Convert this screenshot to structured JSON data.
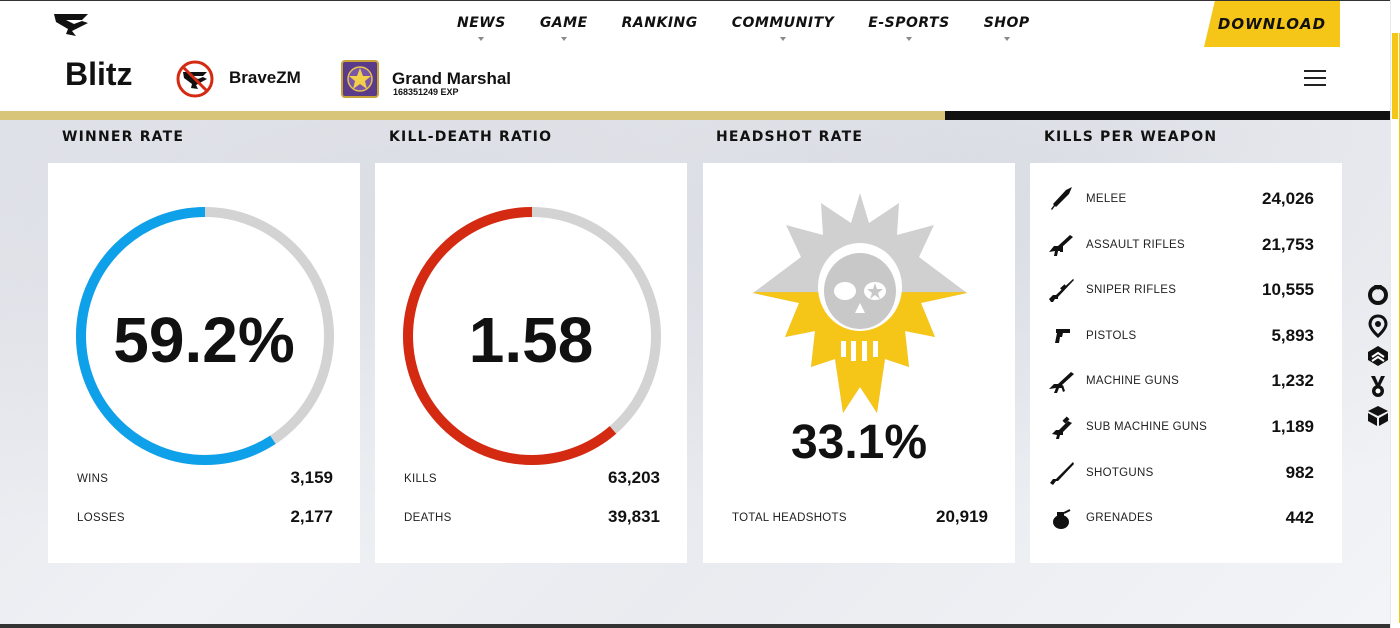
{
  "nav": {
    "items": [
      "NEWS",
      "GAME",
      "RANKING",
      "COMMUNITY",
      "E-SPORTS",
      "SHOP"
    ],
    "items_with_dropdown": [
      true,
      true,
      false,
      true,
      true,
      true
    ],
    "download_label": "DOWNLOAD"
  },
  "player": {
    "name": "Blitz",
    "clan": "BraveZM",
    "rank": "Grand Marshal",
    "exp": "168351249 EXP",
    "exp_progress_fraction": 0.68
  },
  "winner_rate": {
    "title": "WINNER RATE",
    "value": "59.2%",
    "fraction": 0.592,
    "rows": [
      {
        "label": "WINS",
        "value": "3,159"
      },
      {
        "label": "LOSSES",
        "value": "2,177"
      }
    ],
    "color": "#0ea1ea"
  },
  "kd_ratio": {
    "title": "KILL-DEATH RATIO",
    "value": "1.58",
    "fraction": 0.613,
    "rows": [
      {
        "label": "KILLS",
        "value": "63,203"
      },
      {
        "label": "DEATHS",
        "value": "39,831"
      }
    ],
    "color": "#d42a12"
  },
  "headshot": {
    "title": "HEADSHOT RATE",
    "value": "33.1%",
    "fraction": 0.331,
    "rows": [
      {
        "label": "TOTAL HEADSHOTS",
        "value": "20,919"
      }
    ],
    "color": "#f5c518"
  },
  "kills_per_weapon": {
    "title": "KILLS PER WEAPON",
    "rows": [
      {
        "label": "MELEE",
        "value": "24,026",
        "icon": "knife-icon"
      },
      {
        "label": "ASSAULT RIFLES",
        "value": "21,753",
        "icon": "assault-rifle-icon"
      },
      {
        "label": "SNIPER RIFLES",
        "value": "10,555",
        "icon": "sniper-rifle-icon"
      },
      {
        "label": "PISTOLS",
        "value": "5,893",
        "icon": "pistol-icon"
      },
      {
        "label": "MACHINE GUNS",
        "value": "1,232",
        "icon": "machine-gun-icon"
      },
      {
        "label": "SUB MACHINE GUNS",
        "value": "1,189",
        "icon": "smg-icon"
      },
      {
        "label": "SHOTGUNS",
        "value": "982",
        "icon": "shotgun-icon"
      },
      {
        "label": "GRENADES",
        "value": "442",
        "icon": "grenade-icon"
      }
    ]
  },
  "side_nav": [
    "ring-icon",
    "map-pin-icon",
    "rank-chevron-icon",
    "medal-icon",
    "cube-icon"
  ],
  "colors": {
    "accent": "#f5c518",
    "track": "#d3d3d3",
    "exp_bar": "#d9c57a"
  }
}
